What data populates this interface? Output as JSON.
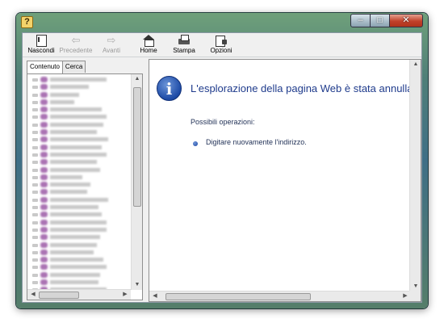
{
  "window": {
    "icon": "help-book-icon",
    "caption_buttons": {
      "minimize": "–",
      "maximize": "□",
      "close": "✕"
    }
  },
  "toolbar": {
    "hide": "Nascondi",
    "back": "Precedente",
    "forward": "Avanti",
    "home": "Home",
    "print": "Stampa",
    "options": "Opzioni"
  },
  "nav": {
    "tabs": [
      "Contenuto",
      "Cerca"
    ],
    "active_tab": "Contenuto"
  },
  "content": {
    "title": "L'esplorazione della pagina Web è stata annullata",
    "possible_actions_label": "Possibili operazioni:",
    "actions": [
      "Digitare nuovamente l'indirizzo."
    ]
  },
  "colors": {
    "heading": "#1f3b8c",
    "body_text": "#1f2f55",
    "info_icon": "#1c4aa6",
    "frame": "#4f7f78"
  }
}
